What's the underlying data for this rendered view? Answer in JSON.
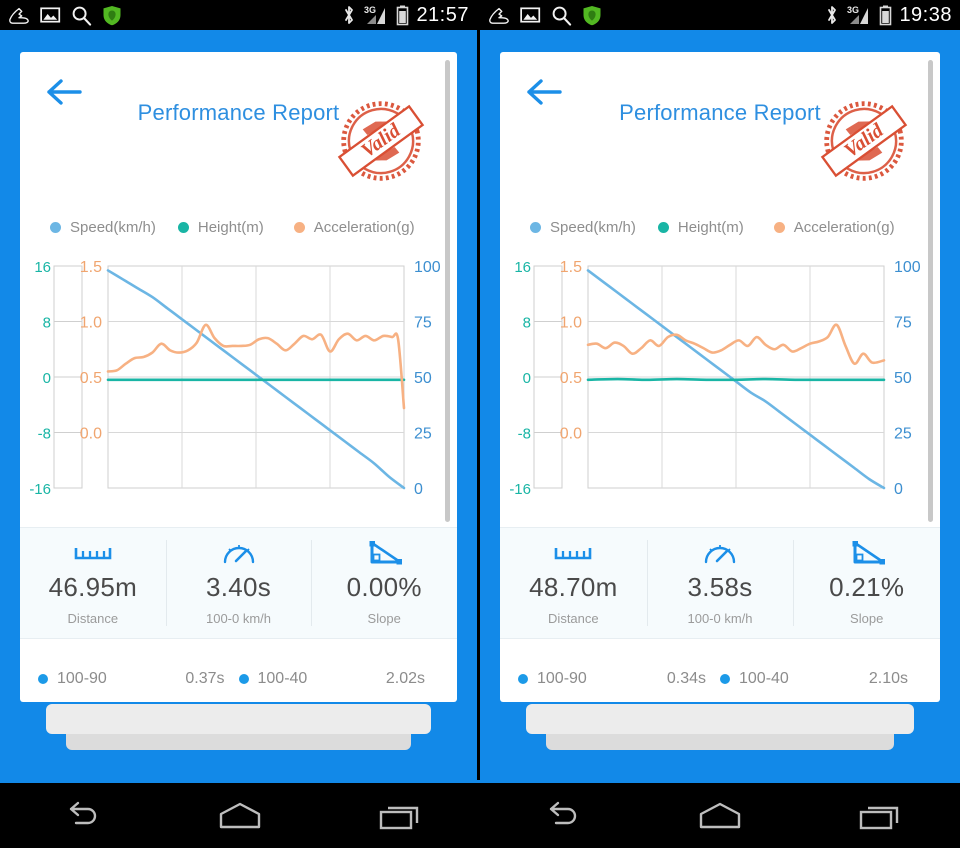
{
  "panes": [
    {
      "id": "left",
      "statusbar": {
        "time": "21:57",
        "icons": [
          "shoe-icon",
          "image-icon",
          "search-icon",
          "shield-icon"
        ],
        "right_icons": [
          "bluetooth-icon",
          "3g-signal-icon",
          "battery-icon"
        ],
        "network_label": "3G"
      },
      "header": {
        "back_icon": "back-arrow-icon",
        "title": "Performance Report",
        "stamp_label": "Valid",
        "stamp_color": "#d94f34"
      },
      "legend": [
        {
          "label": "Speed(km/h)",
          "color": "#6cb6e4"
        },
        {
          "label": "Height(m)",
          "color": "#19b5a5"
        },
        {
          "label": "Acceleration(g)",
          "color": "#f7b183"
        }
      ],
      "stats": [
        {
          "icon": "ruler-icon",
          "value": "46.95m",
          "label": "Distance"
        },
        {
          "icon": "speedometer-icon",
          "value": "3.40s",
          "label": "100-0 km/h"
        },
        {
          "icon": "slope-icon",
          "value": "0.00%",
          "label": "Slope"
        }
      ],
      "timings": [
        {
          "label": "100-90",
          "value": "0.37s"
        },
        {
          "label": "100-40",
          "value": "2.02s"
        }
      ],
      "chart_data": {
        "type": "line",
        "title": "Performance Report",
        "xlabel": "",
        "grid": true,
        "legend_position": "top",
        "axes": {
          "left_outer": {
            "name": "Height(m)",
            "ticks": [
              "16",
              "8",
              "0",
              "-8",
              "-16"
            ],
            "values": [
              16,
              8,
              0,
              -8,
              -16
            ],
            "color": "#19b5a5"
          },
          "left_inner": {
            "name": "Acceleration(g)",
            "ticks": [
              "1.5",
              "1.0",
              "0.5",
              "0.0"
            ],
            "values": [
              1.5,
              1.0,
              0.5,
              0.0
            ],
            "color": "#f0a56f"
          },
          "right": {
            "name": "Speed(km/h)",
            "ticks": [
              "100",
              "75",
              "50",
              "25",
              "0"
            ],
            "values": [
              100,
              75,
              50,
              25,
              0
            ],
            "color": "#3d8fd0"
          }
        },
        "series": [
          {
            "name": "Speed(km/h)",
            "color": "#6cb6e4",
            "axis": "right",
            "x": [
              0,
              5,
              10,
              15,
              20,
              25,
              30,
              35,
              40,
              45,
              50,
              55,
              60,
              65,
              70,
              75,
              80,
              85,
              90,
              95,
              100
            ],
            "values": [
              98,
              94,
              90,
              86,
              81,
              76,
              71,
              66,
              61,
              56,
              51,
              46,
              41,
              36,
              31,
              26,
              21,
              16,
              11,
              5,
              0
            ]
          },
          {
            "name": "Height(m)",
            "color": "#19b5a5",
            "axis": "left_outer",
            "x": [
              0,
              10,
              20,
              30,
              40,
              50,
              60,
              70,
              80,
              90,
              100
            ],
            "values": [
              -0.4,
              -0.4,
              -0.4,
              -0.4,
              -0.4,
              -0.4,
              -0.4,
              -0.4,
              -0.4,
              -0.4,
              -0.4
            ]
          },
          {
            "name": "Acceleration(g)",
            "color": "#f7b183",
            "axis": "left_inner",
            "x": [
              0,
              3,
              6,
              9,
              12,
              15,
              18,
              21,
              24,
              27,
              30,
              33,
              36,
              39,
              42,
              45,
              48,
              51,
              54,
              57,
              60,
              63,
              66,
              69,
              72,
              75,
              78,
              81,
              84,
              87,
              90,
              93,
              96,
              98,
              100
            ],
            "values": [
              0.55,
              0.56,
              0.62,
              0.67,
              0.68,
              0.72,
              0.8,
              0.74,
              0.72,
              0.74,
              0.81,
              0.97,
              0.85,
              0.78,
              0.78,
              0.78,
              0.79,
              0.84,
              0.85,
              0.8,
              0.74,
              0.8,
              0.87,
              0.84,
              0.88,
              0.73,
              0.84,
              0.89,
              0.83,
              0.87,
              0.83,
              0.87,
              0.86,
              0.84,
              0.22
            ]
          }
        ]
      }
    },
    {
      "id": "right",
      "statusbar": {
        "time": "19:38",
        "icons": [
          "shoe-icon",
          "image-icon",
          "search-icon",
          "shield-icon"
        ],
        "right_icons": [
          "bluetooth-icon",
          "3g-signal-icon",
          "battery-icon"
        ],
        "network_label": "3G"
      },
      "header": {
        "back_icon": "back-arrow-icon",
        "title": "Performance Report",
        "stamp_label": "Valid",
        "stamp_color": "#d94f34"
      },
      "legend": [
        {
          "label": "Speed(km/h)",
          "color": "#6cb6e4"
        },
        {
          "label": "Height(m)",
          "color": "#19b5a5"
        },
        {
          "label": "Acceleration(g)",
          "color": "#f7b183"
        }
      ],
      "stats": [
        {
          "icon": "ruler-icon",
          "value": "48.70m",
          "label": "Distance"
        },
        {
          "icon": "speedometer-icon",
          "value": "3.58s",
          "label": "100-0 km/h"
        },
        {
          "icon": "slope-icon",
          "value": "0.21%",
          "label": "Slope"
        }
      ],
      "timings": [
        {
          "label": "100-90",
          "value": "0.34s"
        },
        {
          "label": "100-40",
          "value": "2.10s"
        }
      ],
      "chart_data": {
        "type": "line",
        "title": "Performance Report",
        "xlabel": "",
        "grid": true,
        "legend_position": "top",
        "axes": {
          "left_outer": {
            "name": "Height(m)",
            "ticks": [
              "16",
              "8",
              "0",
              "-8",
              "-16"
            ],
            "values": [
              16,
              8,
              0,
              -8,
              -16
            ],
            "color": "#19b5a5"
          },
          "left_inner": {
            "name": "Acceleration(g)",
            "ticks": [
              "1.5",
              "1.0",
              "0.5",
              "0.0"
            ],
            "values": [
              1.5,
              1.0,
              0.5,
              0.0
            ],
            "color": "#f0a56f"
          },
          "right": {
            "name": "Speed(km/h)",
            "ticks": [
              "100",
              "75",
              "50",
              "25",
              "0"
            ],
            "values": [
              100,
              75,
              50,
              25,
              0
            ],
            "color": "#3d8fd0"
          }
        },
        "series": [
          {
            "name": "Speed(km/h)",
            "color": "#6cb6e4",
            "axis": "right",
            "x": [
              0,
              5,
              10,
              15,
              20,
              25,
              30,
              35,
              40,
              45,
              50,
              55,
              60,
              65,
              70,
              75,
              80,
              85,
              90,
              95,
              100
            ],
            "values": [
              98,
              93,
              88,
              83,
              78,
              73,
              68,
              63,
              58,
              53,
              48,
              43,
              39,
              34,
              29,
              24,
              19,
              14,
              9,
              4,
              0
            ]
          },
          {
            "name": "Height(m)",
            "color": "#19b5a5",
            "axis": "left_outer",
            "x": [
              0,
              10,
              20,
              30,
              40,
              50,
              60,
              70,
              80,
              90,
              100
            ],
            "values": [
              -0.4,
              -0.3,
              -0.4,
              -0.3,
              -0.4,
              -0.4,
              -0.3,
              -0.4,
              -0.4,
              -0.4,
              -0.4
            ]
          },
          {
            "name": "Acceleration(g)",
            "color": "#f7b183",
            "axis": "left_inner",
            "x": [
              0,
              3,
              6,
              9,
              12,
              15,
              18,
              21,
              24,
              27,
              30,
              33,
              36,
              39,
              42,
              45,
              48,
              51,
              54,
              57,
              60,
              63,
              66,
              69,
              72,
              75,
              78,
              81,
              84,
              87,
              90,
              93,
              96,
              100
            ],
            "values": [
              0.79,
              0.8,
              0.76,
              0.81,
              0.78,
              0.71,
              0.76,
              0.83,
              0.78,
              0.86,
              0.88,
              0.83,
              0.8,
              0.76,
              0.72,
              0.74,
              0.79,
              0.83,
              0.78,
              0.86,
              0.79,
              0.75,
              0.79,
              0.73,
              0.76,
              0.8,
              0.82,
              0.86,
              0.97,
              0.78,
              0.62,
              0.71,
              0.63,
              0.65
            ]
          }
        ]
      }
    }
  ],
  "navbar": {
    "buttons": [
      {
        "name": "back-nav-button",
        "icon": "back-nav-icon"
      },
      {
        "name": "home-nav-button",
        "icon": "home-nav-icon"
      },
      {
        "name": "recents-nav-button",
        "icon": "recents-nav-icon"
      }
    ]
  },
  "colors": {
    "app_blue": "#1289e8",
    "title_blue": "#2e8fe0",
    "speed": "#6cb6e4",
    "height": "#19b5a5",
    "accel": "#f7b183",
    "stamp_red": "#d94f34",
    "stat_icon": "#1c8fe8"
  }
}
